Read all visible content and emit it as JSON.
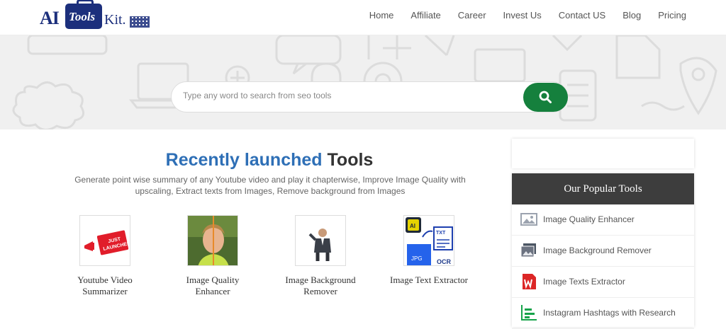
{
  "brand": {
    "logo_alt": "AI Tools Kit"
  },
  "nav": [
    "Home",
    "Affiliate",
    "Career",
    "Invest Us",
    "Contact US",
    "Blog",
    "Pricing"
  ],
  "search": {
    "placeholder": "Type any word to search from seo tools"
  },
  "section": {
    "title_highlight": "Recently launched",
    "title_rest": "Tools",
    "description": "Generate point wise summary of any Youtube video and play it chapterwise, Improve Image Quality with upscaling, Extract texts from Images, Remove background from Images"
  },
  "tools": [
    {
      "name_line1": "Youtube Video",
      "name_line2": "Summarizer",
      "thumb_text1": "JUST",
      "thumb_text2": "LAUNCHED"
    },
    {
      "name_line1": "Image Quality",
      "name_line2": "Enhancer"
    },
    {
      "name_line1": "Image Background",
      "name_line2": "Remover"
    },
    {
      "name_line1": "Image Text Extractor",
      "name_line2": "",
      "thumb_ai": "AI",
      "thumb_txt": "TXT",
      "thumb_jpg": "JPG",
      "thumb_ocr": "OCR"
    }
  ],
  "sidebar": {
    "heading": "Our Popular Tools",
    "items": [
      {
        "label": "Image Quality Enhancer",
        "icon": "image-icon"
      },
      {
        "label": "Image Background Remover",
        "icon": "gallery-icon"
      },
      {
        "label": "Image Texts Extractor",
        "icon": "word-doc-icon"
      },
      {
        "label": "Instagram Hashtags with Research",
        "icon": "chart-icon"
      }
    ]
  },
  "colors": {
    "accent_blue": "#2e6fb6",
    "search_green": "#15803d",
    "sidebar_header": "#3d3d3d",
    "logo_navy": "#1c2f7c"
  }
}
